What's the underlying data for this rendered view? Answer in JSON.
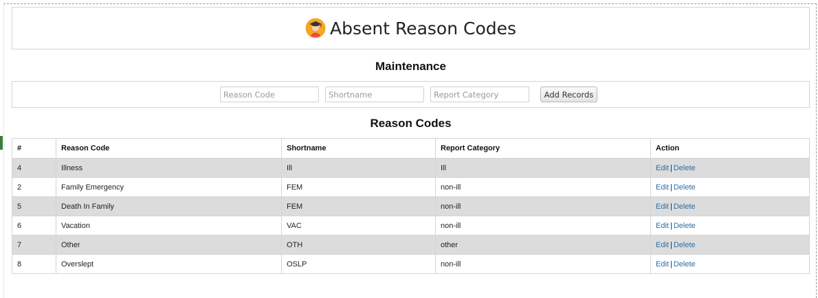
{
  "header": {
    "title": "Absent Reason Codes"
  },
  "maintenance": {
    "title": "Maintenance",
    "reason_code_placeholder": "Reason Code",
    "shortname_placeholder": "Shortname",
    "report_category_placeholder": "Report Category",
    "add_button": "Add Records"
  },
  "codes": {
    "title": "Reason Codes",
    "columns": [
      "#",
      "Reason Code",
      "Shortname",
      "Report Category",
      "Action"
    ],
    "rows": [
      {
        "num": "4",
        "code": "Illness",
        "shortname": "Ill",
        "category": "Ill",
        "edit": "Edit",
        "delete": "Delete"
      },
      {
        "num": "2",
        "code": "Family Emergency",
        "shortname": "FEM",
        "category": "non-ill",
        "edit": "Edit",
        "delete": "Delete"
      },
      {
        "num": "5",
        "code": "Death In Family",
        "shortname": "FEM",
        "category": "non-ill",
        "edit": "Edit",
        "delete": "Delete"
      },
      {
        "num": "6",
        "code": "Vacation",
        "shortname": "VAC",
        "category": "non-ill",
        "edit": "Edit",
        "delete": "Delete"
      },
      {
        "num": "7",
        "code": "Other",
        "shortname": "OTH",
        "category": "other",
        "edit": "Edit",
        "delete": "Delete"
      },
      {
        "num": "8",
        "code": "Overslept",
        "shortname": "OSLP",
        "category": "non-ill",
        "edit": "Edit",
        "delete": "Delete"
      }
    ],
    "separator": "|"
  },
  "colors": {
    "link": "#2a6ea6",
    "row_stripe": "#dcdcdc",
    "icon_bg": "#f5a623"
  },
  "icons": {
    "title_icon": "student-avatar-icon"
  }
}
